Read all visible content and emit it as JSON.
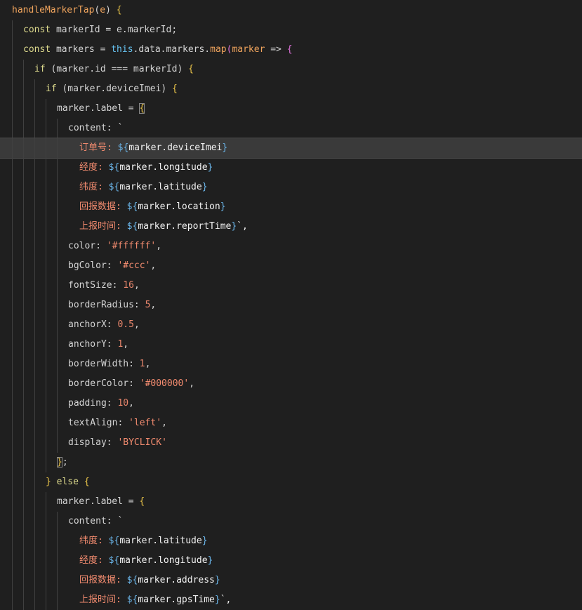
{
  "editor": {
    "colors": {
      "background": "#1f1f1f",
      "active_line": "#3a3a3a",
      "function": "#f0a45d",
      "keyword": "#dcd98c",
      "this_keyword": "#66c2f0",
      "string": "#f28b6f",
      "number": "#e9866c",
      "bracket_yellow": "#e8c349",
      "bracket_pink": "#da70d6"
    },
    "lines": [
      {
        "indent": 0,
        "guides": 0,
        "tokens": [
          {
            "t": "handleMarkerTap",
            "c": "fn"
          },
          {
            "t": "(",
            "c": "punc"
          },
          {
            "t": "e",
            "c": "param"
          },
          {
            "t": ") ",
            "c": "punc"
          },
          {
            "t": "{",
            "c": "brace"
          }
        ]
      },
      {
        "indent": 1,
        "guides": 1,
        "tokens": [
          {
            "t": "const",
            "c": "kw"
          },
          {
            "t": " markerId = e.markerId;",
            "c": "id"
          }
        ]
      },
      {
        "indent": 1,
        "guides": 1,
        "tokens": [
          {
            "t": "const",
            "c": "kw"
          },
          {
            "t": " markers = ",
            "c": "id"
          },
          {
            "t": "this",
            "c": "kw2"
          },
          {
            "t": ".data.markers.",
            "c": "id"
          },
          {
            "t": "map",
            "c": "fn"
          },
          {
            "t": "(",
            "c": "paren"
          },
          {
            "t": "marker",
            "c": "param"
          },
          {
            "t": " => ",
            "c": "op"
          },
          {
            "t": "{",
            "c": "paren"
          }
        ]
      },
      {
        "indent": 2,
        "guides": 2,
        "tokens": [
          {
            "t": "if",
            "c": "kw"
          },
          {
            "t": " (marker.id === markerId) ",
            "c": "id"
          },
          {
            "t": "{",
            "c": "brace"
          }
        ]
      },
      {
        "indent": 3,
        "guides": 3,
        "tokens": [
          {
            "t": "if",
            "c": "kw"
          },
          {
            "t": " (marker.deviceImei) ",
            "c": "id"
          },
          {
            "t": "{",
            "c": "brace"
          }
        ]
      },
      {
        "indent": 4,
        "guides": 4,
        "tokens": [
          {
            "t": "marker.label = ",
            "c": "id"
          },
          {
            "t": "{",
            "c": "brace-box"
          }
        ]
      },
      {
        "indent": 5,
        "guides": 5,
        "tokens": [
          {
            "t": "content: `",
            "c": "id"
          }
        ]
      },
      {
        "indent": 6,
        "guides": 5,
        "active": true,
        "tokens": [
          {
            "t": "订单号: ",
            "c": "cn"
          },
          {
            "t": "${",
            "c": "interp"
          },
          {
            "t": "marker.deviceImei",
            "c": "tpl"
          },
          {
            "t": "}",
            "c": "interp"
          }
        ]
      },
      {
        "indent": 6,
        "guides": 5,
        "tokens": [
          {
            "t": "经度: ",
            "c": "cn"
          },
          {
            "t": "${",
            "c": "interp"
          },
          {
            "t": "marker.longitude",
            "c": "tpl"
          },
          {
            "t": "}",
            "c": "interp"
          }
        ]
      },
      {
        "indent": 6,
        "guides": 5,
        "tokens": [
          {
            "t": "纬度: ",
            "c": "cn"
          },
          {
            "t": "${",
            "c": "interp"
          },
          {
            "t": "marker.latitude",
            "c": "tpl"
          },
          {
            "t": "}",
            "c": "interp"
          }
        ]
      },
      {
        "indent": 6,
        "guides": 5,
        "tokens": [
          {
            "t": "回报数据: ",
            "c": "cn"
          },
          {
            "t": "${",
            "c": "interp"
          },
          {
            "t": "marker.location",
            "c": "tpl"
          },
          {
            "t": "}",
            "c": "interp"
          }
        ]
      },
      {
        "indent": 6,
        "guides": 5,
        "tokens": [
          {
            "t": "上报时间: ",
            "c": "cn"
          },
          {
            "t": "${",
            "c": "interp"
          },
          {
            "t": "marker.reportTime",
            "c": "tpl"
          },
          {
            "t": "}",
            "c": "interp"
          },
          {
            "t": "`,",
            "c": "tpl"
          }
        ]
      },
      {
        "indent": 5,
        "guides": 5,
        "tokens": [
          {
            "t": "color: ",
            "c": "id"
          },
          {
            "t": "'#ffffff'",
            "c": "str"
          },
          {
            "t": ",",
            "c": "punc"
          }
        ]
      },
      {
        "indent": 5,
        "guides": 5,
        "tokens": [
          {
            "t": "bgColor: ",
            "c": "id"
          },
          {
            "t": "'#ccc'",
            "c": "str"
          },
          {
            "t": ",",
            "c": "punc"
          }
        ]
      },
      {
        "indent": 5,
        "guides": 5,
        "tokens": [
          {
            "t": "fontSize: ",
            "c": "id"
          },
          {
            "t": "16",
            "c": "num"
          },
          {
            "t": ",",
            "c": "punc"
          }
        ]
      },
      {
        "indent": 5,
        "guides": 5,
        "tokens": [
          {
            "t": "borderRadius: ",
            "c": "id"
          },
          {
            "t": "5",
            "c": "num"
          },
          {
            "t": ",",
            "c": "punc"
          }
        ]
      },
      {
        "indent": 5,
        "guides": 5,
        "tokens": [
          {
            "t": "anchorX: ",
            "c": "id"
          },
          {
            "t": "0.5",
            "c": "num"
          },
          {
            "t": ",",
            "c": "punc"
          }
        ]
      },
      {
        "indent": 5,
        "guides": 5,
        "tokens": [
          {
            "t": "anchorY: ",
            "c": "id"
          },
          {
            "t": "1",
            "c": "num"
          },
          {
            "t": ",",
            "c": "punc"
          }
        ]
      },
      {
        "indent": 5,
        "guides": 5,
        "tokens": [
          {
            "t": "borderWidth: ",
            "c": "id"
          },
          {
            "t": "1",
            "c": "num"
          },
          {
            "t": ",",
            "c": "punc"
          }
        ]
      },
      {
        "indent": 5,
        "guides": 5,
        "tokens": [
          {
            "t": "borderColor: ",
            "c": "id"
          },
          {
            "t": "'#000000'",
            "c": "str"
          },
          {
            "t": ",",
            "c": "punc"
          }
        ]
      },
      {
        "indent": 5,
        "guides": 5,
        "tokens": [
          {
            "t": "padding: ",
            "c": "id"
          },
          {
            "t": "10",
            "c": "num"
          },
          {
            "t": ",",
            "c": "punc"
          }
        ]
      },
      {
        "indent": 5,
        "guides": 5,
        "tokens": [
          {
            "t": "textAlign: ",
            "c": "id"
          },
          {
            "t": "'left'",
            "c": "str"
          },
          {
            "t": ",",
            "c": "punc"
          }
        ]
      },
      {
        "indent": 5,
        "guides": 5,
        "tokens": [
          {
            "t": "display: ",
            "c": "id"
          },
          {
            "t": "'BYCLICK'",
            "c": "str"
          }
        ]
      },
      {
        "indent": 4,
        "guides": 4,
        "tokens": [
          {
            "t": "}",
            "c": "brace-box"
          },
          {
            "t": ";",
            "c": "punc"
          }
        ]
      },
      {
        "indent": 3,
        "guides": 3,
        "tokens": [
          {
            "t": "}",
            "c": "brace"
          },
          {
            "t": " ",
            "c": "id"
          },
          {
            "t": "else",
            "c": "kw"
          },
          {
            "t": " ",
            "c": "id"
          },
          {
            "t": "{",
            "c": "brace"
          }
        ]
      },
      {
        "indent": 4,
        "guides": 4,
        "tokens": [
          {
            "t": "marker.label = ",
            "c": "id"
          },
          {
            "t": "{",
            "c": "brace"
          }
        ]
      },
      {
        "indent": 5,
        "guides": 5,
        "tokens": [
          {
            "t": "content: `",
            "c": "id"
          }
        ]
      },
      {
        "indent": 6,
        "guides": 5,
        "tokens": [
          {
            "t": "纬度: ",
            "c": "cn"
          },
          {
            "t": "${",
            "c": "interp"
          },
          {
            "t": "marker.latitude",
            "c": "tpl"
          },
          {
            "t": "}",
            "c": "interp"
          }
        ]
      },
      {
        "indent": 6,
        "guides": 5,
        "tokens": [
          {
            "t": "经度: ",
            "c": "cn"
          },
          {
            "t": "${",
            "c": "interp"
          },
          {
            "t": "marker.longitude",
            "c": "tpl"
          },
          {
            "t": "}",
            "c": "interp"
          }
        ]
      },
      {
        "indent": 6,
        "guides": 5,
        "tokens": [
          {
            "t": "回报数据: ",
            "c": "cn"
          },
          {
            "t": "${",
            "c": "interp"
          },
          {
            "t": "marker.address",
            "c": "tpl"
          },
          {
            "t": "}",
            "c": "interp"
          }
        ]
      },
      {
        "indent": 6,
        "guides": 5,
        "tokens": [
          {
            "t": "上报时间: ",
            "c": "cn"
          },
          {
            "t": "${",
            "c": "interp"
          },
          {
            "t": "marker.gpsTime",
            "c": "tpl"
          },
          {
            "t": "}",
            "c": "interp"
          },
          {
            "t": "`,",
            "c": "tpl"
          }
        ]
      }
    ]
  }
}
